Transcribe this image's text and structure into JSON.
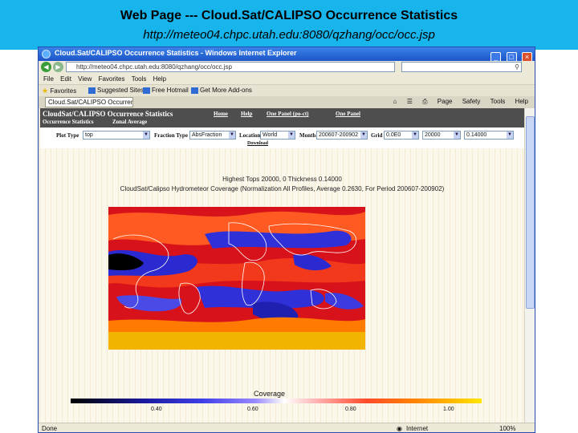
{
  "slide": {
    "title": "Web Page --- Cloud.Sat/CALIPSO Occurrence Statistics",
    "url": "http://meteo04.chpc.utah.edu:8080/qzhang/occ/occ.jsp"
  },
  "browser": {
    "window_title": "Cloud.Sat/CALIPSO Occurrence Statistics - Windows Internet Explorer",
    "address": "http://meteo04.chpc.utah.edu:8080/qzhang/occ/occ.jsp",
    "menu": [
      "File",
      "Edit",
      "View",
      "Favorites",
      "Tools",
      "Help"
    ],
    "favorites_label": "Favorites",
    "favorites": [
      "Suggested Sites",
      "Free Hotmail",
      "Get More Add-ons"
    ],
    "tab_title": "Cloud.Sat/CALIPSO Occurrence...",
    "tools": [
      "Page",
      "Safety",
      "Tools",
      "Help"
    ],
    "status_left": "Done",
    "status_zone": "Internet",
    "zoom": "100%"
  },
  "page": {
    "header_title": "CloudSat/CALIPSO Occurrence Statistics",
    "tabs": [
      "Occurrence Statistics",
      "Zonal Average"
    ],
    "links": [
      "Home",
      "Help",
      "One Panel (po-ct)",
      "One Panel"
    ],
    "controls": {
      "plot_type_label": "Plot Type",
      "plot_type": "top",
      "fraction_type_label": "Fraction Type",
      "fraction_type": "AbsFraction",
      "location_label": "Location",
      "location": "World",
      "month_label": "Month",
      "month": "200607-200902",
      "grid_label": "Grid",
      "grid_from": "0.0E0",
      "grid_to": "20000",
      "grid_value": "0.14000",
      "download": "Download"
    },
    "figure_title_1": "Highest Tops 20000, 0 Thickness 0.14000",
    "figure_title_2": "CloudSat/Calipso Hydrometeor Coverage (Normalization All Profiles, Average 0.2630, For Period 200607-200902)",
    "colorbar_label": "Coverage",
    "colorbar_ticks": [
      "0.40",
      "0.60",
      "0.80",
      "1.00"
    ]
  },
  "colors": {
    "header_bg": "#18b4ec",
    "app_header_bg": "#4e4e4e",
    "map_red": "#d8121a",
    "map_blue": "#2a2ad0",
    "map_yellow": "#f7c600"
  }
}
